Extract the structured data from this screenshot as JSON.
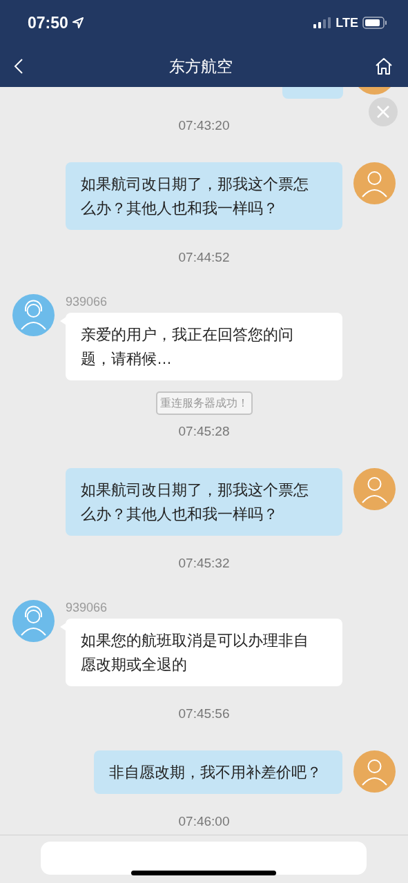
{
  "status_bar": {
    "time": "07:50",
    "network": "LTE"
  },
  "nav": {
    "title": "东方航空"
  },
  "messages": [
    {
      "kind": "partial_user"
    },
    {
      "kind": "time",
      "text": "07:43:20"
    },
    {
      "kind": "user",
      "text": "如果航司改日期了，那我这个票怎么办？其他人也和我一样吗？"
    },
    {
      "kind": "time",
      "text": "07:44:52"
    },
    {
      "kind": "agent",
      "sender": "939066",
      "text": "亲爱的用户，我正在回答您的问题，请稍候…"
    },
    {
      "kind": "notice",
      "text": "重连服务器成功！"
    },
    {
      "kind": "time",
      "text": "07:45:28"
    },
    {
      "kind": "user",
      "text": "如果航司改日期了，那我这个票怎么办？其他人也和我一样吗？"
    },
    {
      "kind": "time",
      "text": "07:45:32"
    },
    {
      "kind": "agent",
      "sender": "939066",
      "text": "如果您的航班取消是可以办理非自愿改期或全退的"
    },
    {
      "kind": "time",
      "text": "07:45:56"
    },
    {
      "kind": "user",
      "text": "非自愿改期，我不用补差价吧？"
    },
    {
      "kind": "time",
      "text": "07:46:00"
    }
  ]
}
